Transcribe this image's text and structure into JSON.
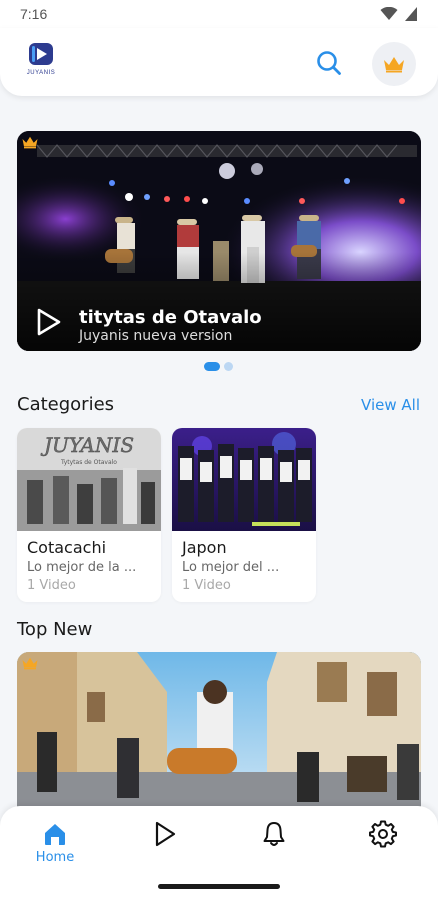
{
  "status_bar": {
    "time": "7:16"
  },
  "header": {
    "logo_text": "JUYANIS"
  },
  "hero": {
    "title": "titytas de Otavalo",
    "subtitle": "Juyanis nueva version",
    "slide_count": 2,
    "active_slide": 1
  },
  "categories": {
    "title": "Categories",
    "view_all": "View All",
    "items": [
      {
        "name": "Cotacachi",
        "description": "Lo mejor de la ...",
        "count": "1 Video",
        "image_caption": "Tytytas de Otavalo"
      },
      {
        "name": "Japon",
        "description": "Lo mejor del ...",
        "count": "1 Video"
      }
    ]
  },
  "top_new": {
    "title": "Top New"
  },
  "bottom_nav": {
    "items": [
      {
        "label": "Home",
        "active": true,
        "icon": "home-icon"
      },
      {
        "label": "",
        "active": false,
        "icon": "play-icon"
      },
      {
        "label": "",
        "active": false,
        "icon": "bell-icon"
      },
      {
        "label": "",
        "active": false,
        "icon": "gear-icon"
      }
    ]
  },
  "colors": {
    "accent": "#2a8fe8",
    "crown": "#f5a623",
    "background": "#f4f6f9"
  }
}
